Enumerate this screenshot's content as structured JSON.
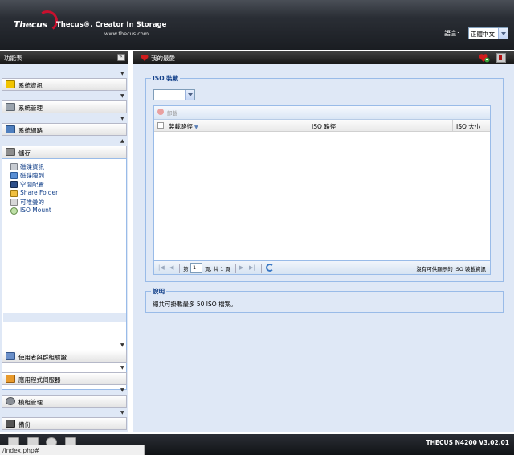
{
  "header": {
    "logo_text": "Thecus",
    "tagline": "Thecus®. Creator In Storage",
    "website": "www.thecus.com",
    "language_label": "語言:",
    "language_value": "正體中文"
  },
  "left_panel": {
    "title": "功能表",
    "sections": [
      {
        "label": "系統資訊"
      },
      {
        "label": "系統管理"
      },
      {
        "label": "系統網路"
      },
      {
        "label": "儲存"
      },
      {
        "label": "使用者與群組驗證"
      },
      {
        "label": "應用程式伺服器"
      },
      {
        "label": "模組管理"
      },
      {
        "label": "備份"
      }
    ],
    "storage_items": [
      {
        "label": "磁碟資訊"
      },
      {
        "label": "磁碟陣列"
      },
      {
        "label": "空間配置"
      },
      {
        "label": "Share Folder"
      },
      {
        "label": "可堆疊的"
      },
      {
        "label": "ISO Mount"
      }
    ]
  },
  "right_panel": {
    "title": "我的最愛",
    "iso_section": {
      "legend": "ISO 裝載",
      "unmount_label": "卸載",
      "columns": [
        "裝載路徑",
        "ISO 路徑",
        "ISO 大小"
      ],
      "pager": {
        "page_prefix": "第",
        "page_value": "1",
        "page_suffix": "頁, 共 1 頁",
        "empty_message": "沒有可供顯示的 ISO 裝載資訊"
      }
    },
    "description": {
      "legend": "說明",
      "text": "總共可掛載最多 50 ISO 檔案。"
    }
  },
  "footer": {
    "version": "THECUS N4200 V3.02.01",
    "status_url": "/index.php#"
  }
}
